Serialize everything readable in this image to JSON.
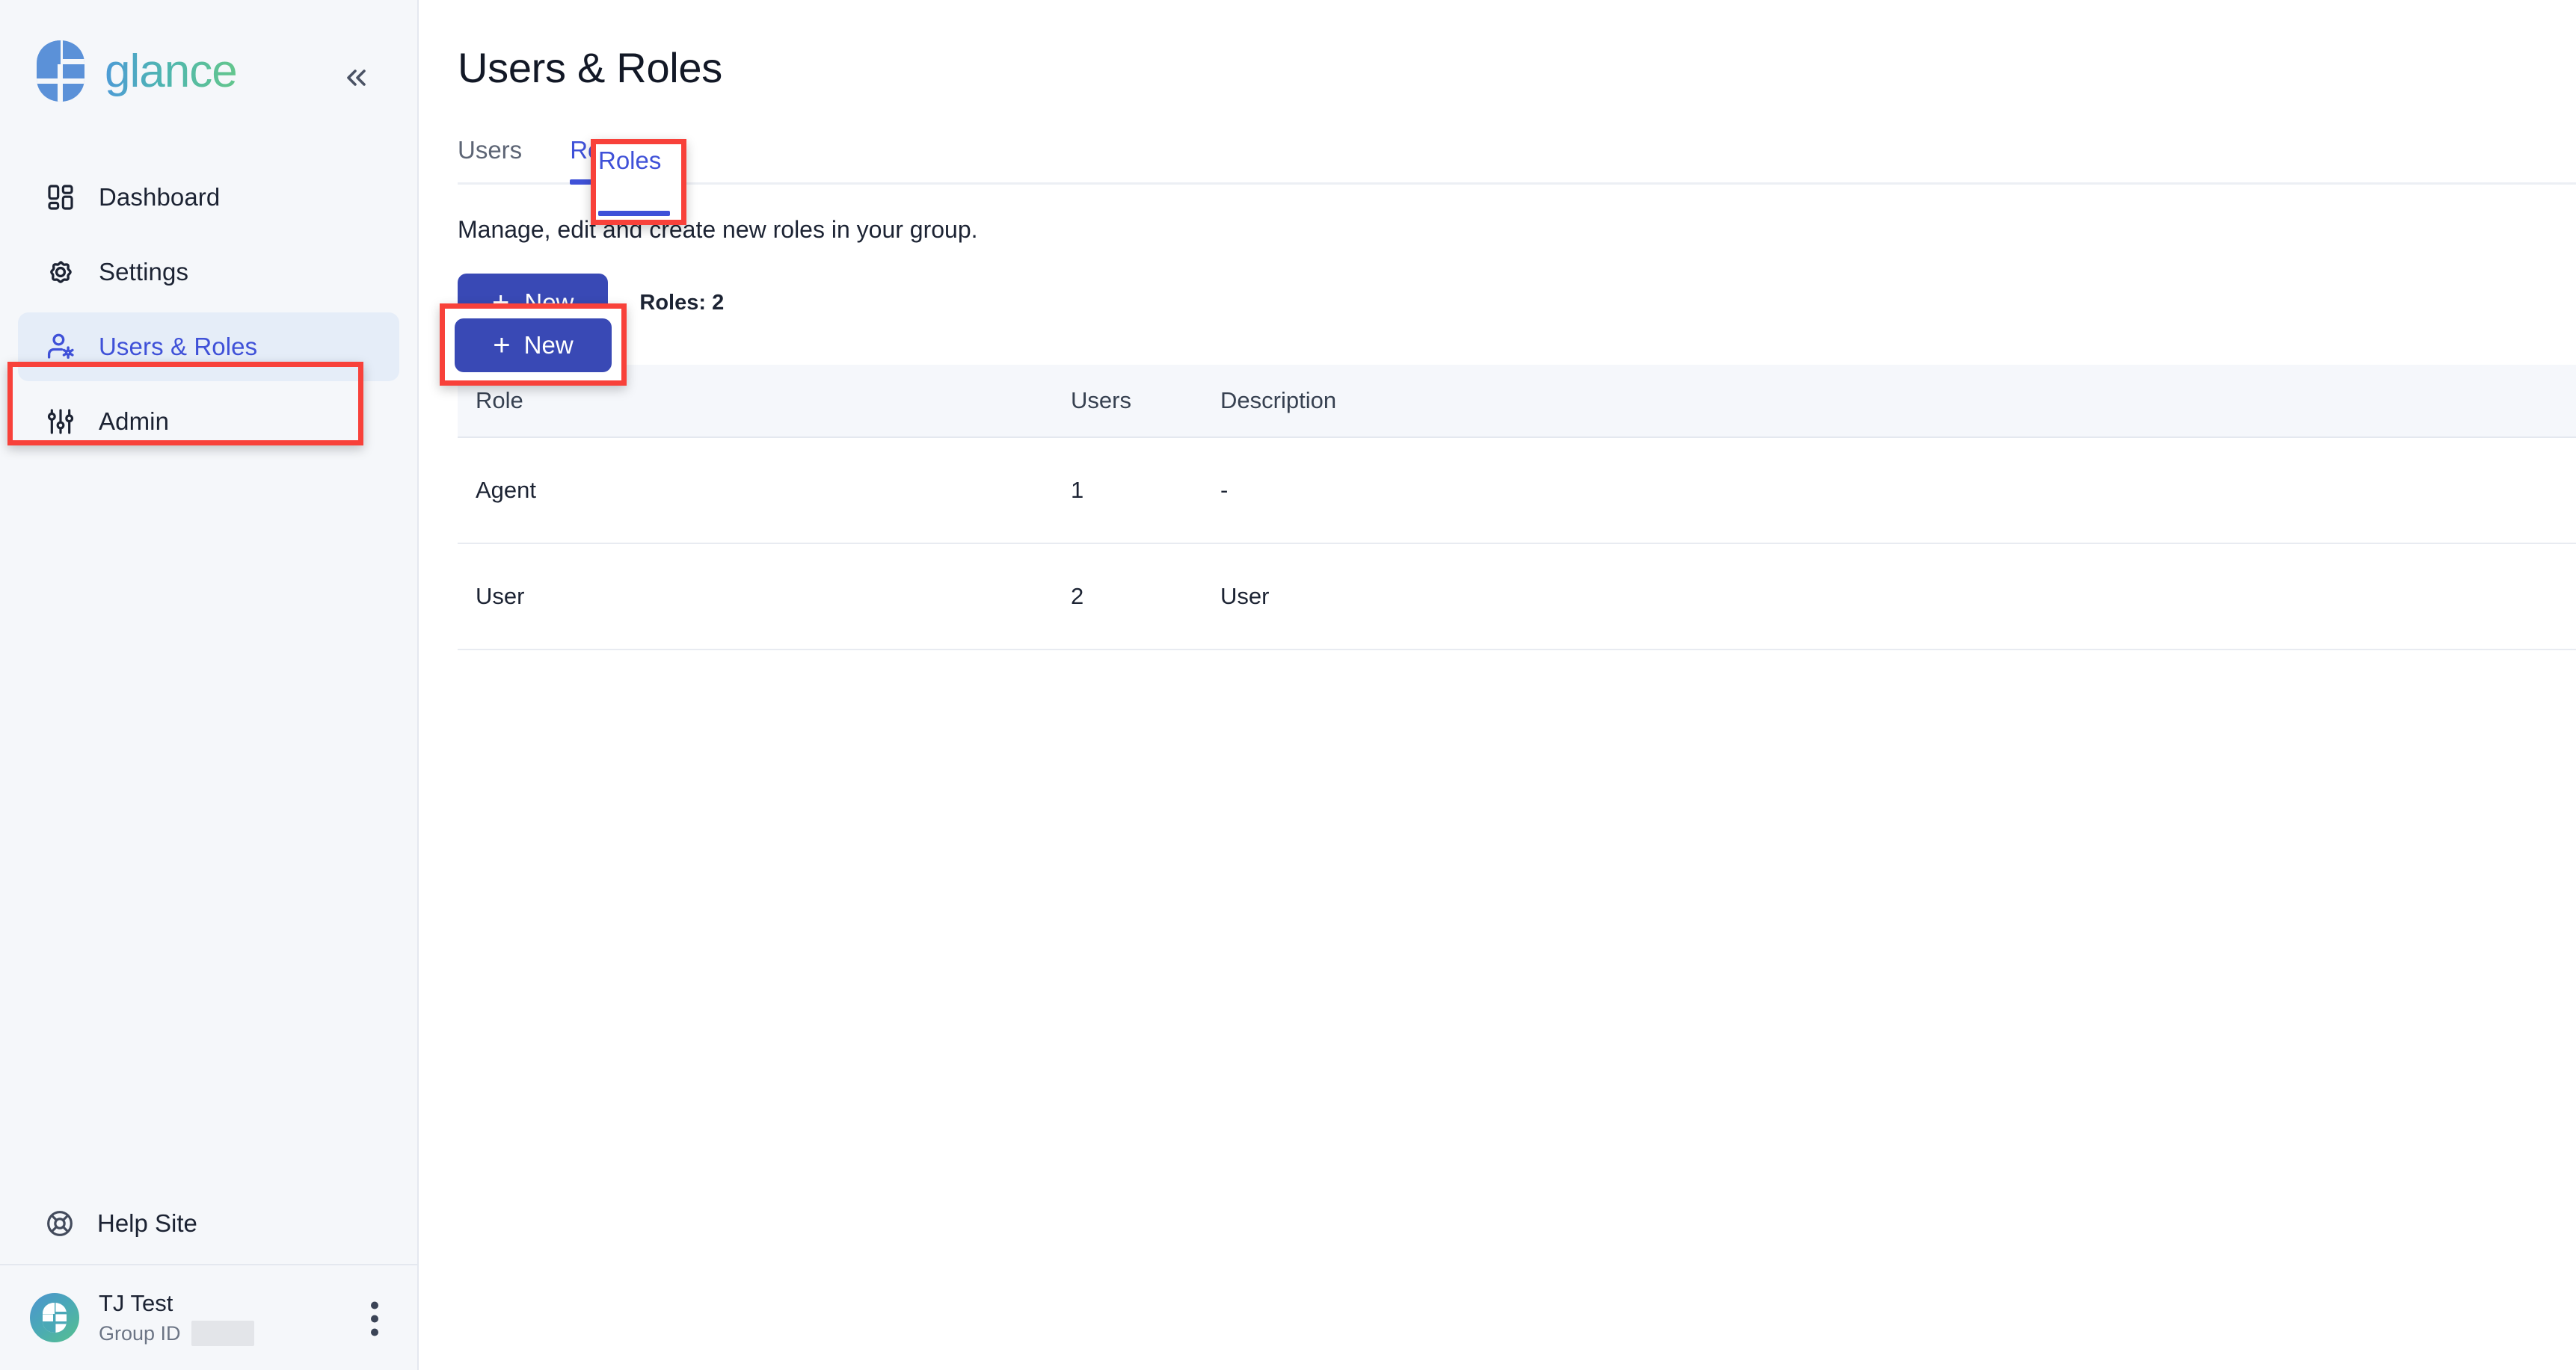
{
  "brand": {
    "name": "glance",
    "logo_icon": "glance-logo-mark",
    "collapse_icon": "chevron-double-left-icon"
  },
  "sidebar": {
    "items": [
      {
        "label": "Dashboard",
        "icon": "dashboard-grid-icon",
        "active": false
      },
      {
        "label": "Settings",
        "icon": "gear-icon",
        "active": false
      },
      {
        "label": "Users & Roles",
        "icon": "user-settings-icon",
        "active": true
      },
      {
        "label": "Admin",
        "icon": "sliders-icon",
        "active": false
      }
    ],
    "help": {
      "label": "Help Site",
      "icon": "lifebuoy-icon"
    },
    "profile": {
      "name": "TJ Test",
      "group_id_label": "Group ID",
      "group_id_value": "",
      "avatar_icon": "glance-avatar",
      "menu_icon": "kebab-menu-icon"
    }
  },
  "main": {
    "page_title": "Users & Roles",
    "tabs": [
      {
        "label": "Users",
        "active": false
      },
      {
        "label": "Roles",
        "active": true
      }
    ],
    "subtitle": "Manage, edit and create new roles in your group.",
    "toolbar": {
      "new_button_label": "New",
      "new_button_icon": "plus-icon",
      "roles_count": "Roles: 2"
    },
    "table": {
      "columns": [
        "Role",
        "Users",
        "Description",
        ""
      ],
      "rows": [
        {
          "role": "Agent",
          "users": "1",
          "description": "-",
          "menu_icon": "kebab-menu-icon"
        },
        {
          "role": "User",
          "users": "2",
          "description": "User",
          "menu_icon": "kebab-menu-icon"
        }
      ]
    }
  },
  "annotations": {
    "highlight_color": "#f8413a",
    "boxes": [
      "sidebar-item-users-roles",
      "tab-roles",
      "new-button"
    ]
  },
  "colors": {
    "accent_blue": "#3f51d8",
    "button_blue": "#3949b5",
    "sidebar_bg": "#f5f7fa",
    "active_item_bg": "#e5edf8",
    "table_header_bg": "#f5f7fb",
    "logo_blue": "#5b91d8",
    "logo_green": "#63c68c"
  }
}
